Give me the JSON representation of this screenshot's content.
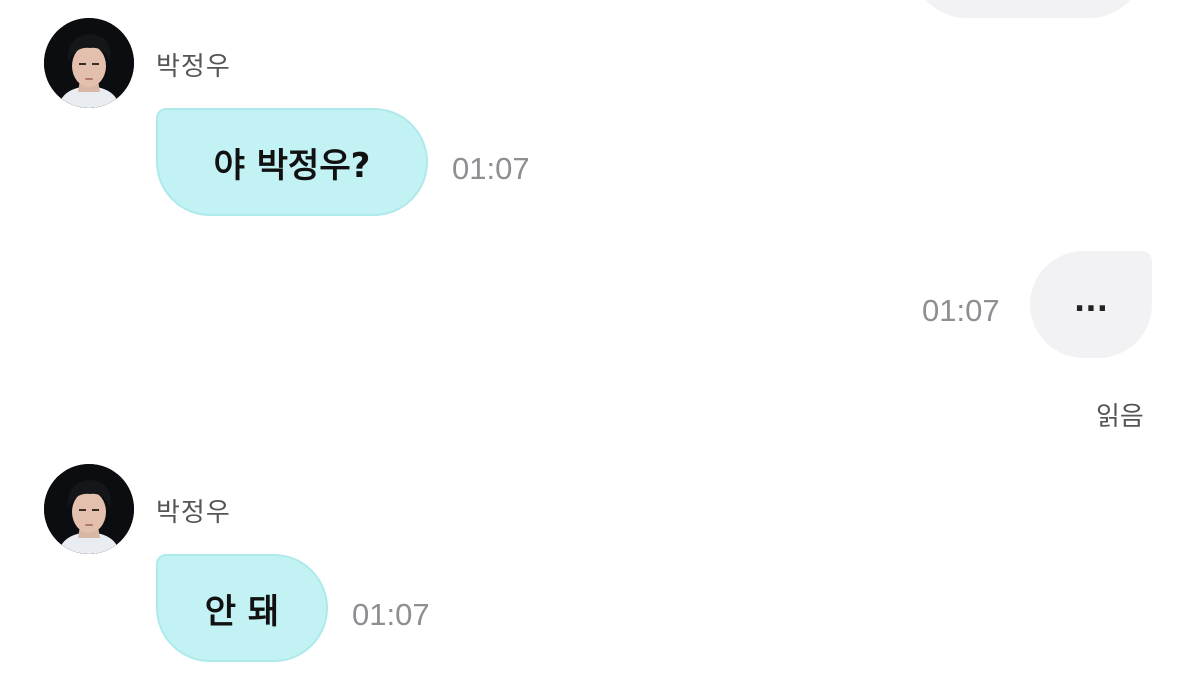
{
  "conversation": {
    "top_partial_bubble": {
      "text": ""
    },
    "messages": [
      {
        "direction": "incoming",
        "sender": "박정우",
        "text": "야 박정우?",
        "time": "01:07"
      },
      {
        "direction": "outgoing",
        "text": "...",
        "time": "01:07",
        "status": "읽음"
      },
      {
        "direction": "incoming",
        "sender": "박정우",
        "text": "안 돼",
        "time": "01:07"
      }
    ]
  },
  "colors": {
    "incoming_bubble": "#c2f2f4",
    "incoming_border": "#aee9ec",
    "outgoing_bubble": "#f2f2f5",
    "time_text": "#8e8e93",
    "name_text": "#555555"
  }
}
